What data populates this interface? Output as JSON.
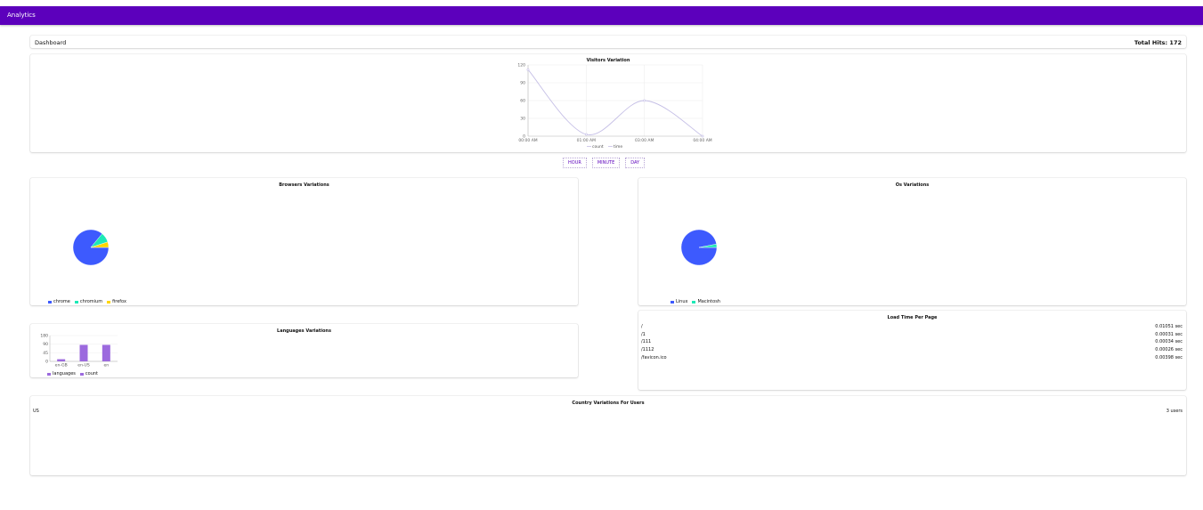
{
  "app": {
    "title": "Analytics"
  },
  "dashboard": {
    "label": "Dashboard",
    "total_hits": "Total Hits: 172"
  },
  "visitors": {
    "title": "Visitors Variation",
    "legend": [
      "count",
      "time"
    ],
    "line_color": "#c5bfe6"
  },
  "buttons": {
    "hour": "HOUR",
    "minute": "MINUTE",
    "day": "DAY"
  },
  "browsers": {
    "title": "Browsers Variations",
    "legend": [
      {
        "label": "chrome",
        "color": "#3d5afe"
      },
      {
        "label": "chromium",
        "color": "#1de9b6"
      },
      {
        "label": "firefox",
        "color": "#ffd600"
      }
    ]
  },
  "os": {
    "title": "Os Variations",
    "legend": [
      {
        "label": "Linux",
        "color": "#3d5afe"
      },
      {
        "label": "Macintosh",
        "color": "#1de9b6"
      }
    ]
  },
  "languages": {
    "title": "Languages Variations",
    "legend": [
      {
        "label": "languages",
        "color": "#9c6ade"
      },
      {
        "label": "count",
        "color": "#9c6ade"
      }
    ]
  },
  "load_time": {
    "title": "Load Time Per Page",
    "rows": [
      {
        "page": "/",
        "time": "0.01051 sec"
      },
      {
        "page": "/1",
        "time": "0.00031 sec"
      },
      {
        "page": "/111",
        "time": "0.00034 sec"
      },
      {
        "page": "/1112",
        "time": "0.00026 sec"
      },
      {
        "page": "/favicon.ico",
        "time": "0.00398 sec"
      }
    ]
  },
  "country": {
    "title": "Country Variations For Users",
    "rows": [
      {
        "country": "US",
        "users": "3 users"
      }
    ]
  },
  "chart_data": [
    {
      "type": "line",
      "title": "Visitors Variation",
      "x": [
        "00:00 AM",
        "01:00 AM",
        "03:00 AM",
        "04:00 AM"
      ],
      "series": [
        {
          "name": "count",
          "values": [
            112,
            3,
            60,
            0
          ]
        }
      ],
      "yticks": [
        0,
        30,
        60,
        90,
        120
      ],
      "ylim": [
        0,
        120
      ],
      "grid": true,
      "legend": "bottom"
    },
    {
      "type": "pie",
      "title": "Browsers Variations",
      "labels": [
        "chrome",
        "chromium",
        "firefox"
      ],
      "values": [
        86,
        9,
        5
      ],
      "legend": "bottom-left"
    },
    {
      "type": "pie",
      "title": "Os Variations",
      "labels": [
        "Linux",
        "Macintosh"
      ],
      "values": [
        97,
        3
      ],
      "legend": "bottom-left"
    },
    {
      "type": "bar",
      "title": "Languages Variations",
      "categories": [
        "en-GB",
        "en-US",
        "en"
      ],
      "yticks": [
        0,
        45,
        90,
        180
      ],
      "ylim": [
        0,
        180
      ],
      "series": [
        {
          "name": "count",
          "values": [
            15,
            115,
            115
          ]
        }
      ],
      "legend": "bottom-left"
    }
  ]
}
